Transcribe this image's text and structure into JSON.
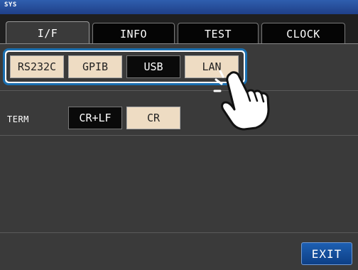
{
  "header": {
    "title": "SYS"
  },
  "tabs": [
    {
      "label": "I/F",
      "active": true
    },
    {
      "label": "INFO",
      "active": false
    },
    {
      "label": "TEST",
      "active": false
    },
    {
      "label": "CLOCK",
      "active": false
    }
  ],
  "interface_select": {
    "options": [
      "RS232C",
      "GPIB",
      "USB",
      "LAN"
    ],
    "selected": "USB",
    "highlight_color": "#1a6fb0"
  },
  "term": {
    "label": "TERM",
    "options": [
      "CR+LF",
      "CR"
    ],
    "selected": "CR+LF"
  },
  "footer": {
    "exit_label": "EXIT"
  },
  "icons": {
    "pointer": "hand-pointer-icon"
  }
}
